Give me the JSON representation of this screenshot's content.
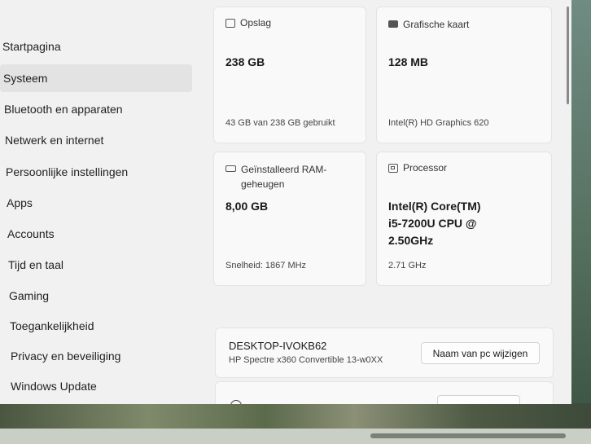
{
  "nav": {
    "items": [
      {
        "label": "Startpagina"
      },
      {
        "label": "Systeem"
      },
      {
        "label": "Bluetooth en apparaten"
      },
      {
        "label": "Netwerk en internet"
      },
      {
        "label": "Persoonlijke instellingen"
      },
      {
        "label": "Apps"
      },
      {
        "label": "Accounts"
      },
      {
        "label": "Tijd en taal"
      },
      {
        "label": "Gaming"
      },
      {
        "label": "Toegankelijkheid"
      },
      {
        "label": "Privacy en beveiliging"
      },
      {
        "label": "Windows Update"
      }
    ],
    "active": "Systeem"
  },
  "specs": {
    "storage": {
      "title": "Opslag",
      "value": "238 GB",
      "detail": "43 GB van 238 GB gebruikt"
    },
    "graphics": {
      "title": "Grafische kaart",
      "value": "128 MB",
      "detail": "Intel(R) HD Graphics 620"
    },
    "ram": {
      "title_line1": "Geïnstalleerd RAM-",
      "title_line2": "geheugen",
      "value": "8,00 GB",
      "detail": "Snelheid: 1867 MHz"
    },
    "processor": {
      "title": "Processor",
      "value_line1": "Intel(R) Core(TM)",
      "value_line2": "i5-7200U CPU @",
      "value_line3": "2.50GHz",
      "detail": "2.71 GHz"
    }
  },
  "device": {
    "name": "DESKTOP-IVOKB62",
    "model": "HP Spectre x360 Convertible 13-w0XX",
    "rename_label": "Naam van pc wijzigen"
  },
  "icons": {
    "storage": "storage-icon",
    "graphics": "graphics-card-icon",
    "ram": "ram-icon",
    "processor": "processor-icon"
  }
}
